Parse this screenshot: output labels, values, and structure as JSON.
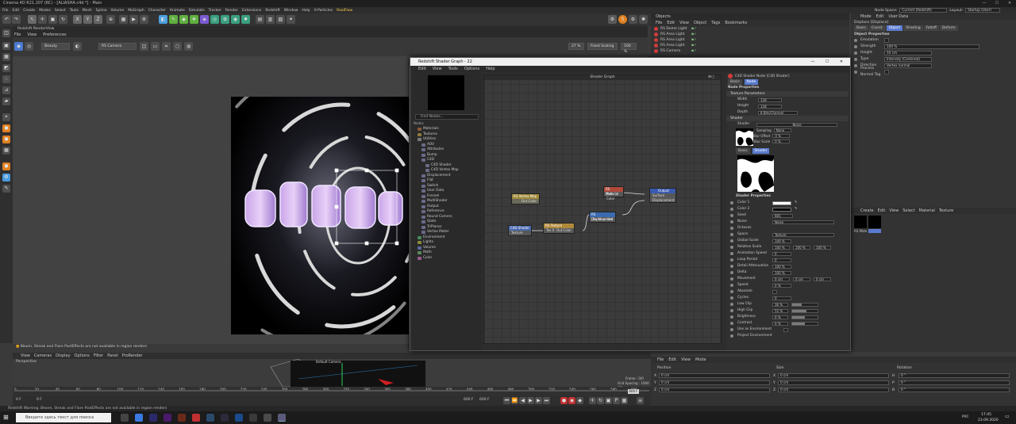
{
  "app": {
    "title": "Cinema 4D R21.207 (RC) - [ALIASHA.c4d *] - Main",
    "menu": [
      "File",
      "Edit",
      "Create",
      "Modes",
      "Select",
      "Tools",
      "Mesh",
      "Spline",
      "Volume",
      "MoGraph",
      "Character",
      "Animate",
      "Simulate",
      "Tracker",
      "Render",
      "Extensions",
      "Redshift",
      "Window",
      "Help",
      "X-Particles",
      "RealFlow"
    ],
    "node_space_label": "Node Space:",
    "node_space_value": "Current (Redshift)",
    "layout_label": "Layout:",
    "layout_value": "Startup (User)"
  },
  "toolbar": {
    "x": "X",
    "y": "Y",
    "z": "Z"
  },
  "renderview": {
    "title": "Redshift RenderView",
    "menu": [
      "File",
      "View",
      "Preferences"
    ],
    "beauty": "Beauty",
    "camera": "RS Camera",
    "zoom": "27 %",
    "fixed_scaling": "Fixed Scaling",
    "percent": "100 %",
    "warning": "Bloom, Streak and Flare PostEffects are not available in region renders"
  },
  "viewport": {
    "menu": [
      "View",
      "Cameras",
      "Display",
      "Options",
      "Filter",
      "Panel",
      "ProRender"
    ],
    "label": "Perspective",
    "camera_label": "Default Camera",
    "frame": "Frame : 0/0",
    "grid": "Grid Spacing : 1000 cm"
  },
  "timeline": {
    "ticks": [
      "0",
      "20",
      "40",
      "60",
      "80",
      "100",
      "120",
      "140",
      "160",
      "180",
      "200",
      "220",
      "240",
      "260",
      "280",
      "300",
      "320",
      "340",
      "360",
      "380",
      "400",
      "420",
      "440",
      "460",
      "480",
      "500",
      "520",
      "540",
      "560",
      "580",
      "600"
    ],
    "start": "0 F",
    "end_a": "600 F",
    "end_b": "600 F",
    "current": "600 F",
    "current_b": "0 F"
  },
  "statusbar": "Redshift Warning: Bloom, Streak and Flare PostEffects are not available in region renders",
  "taskbar": {
    "search": "Введите здесь текст для поиска",
    "time": "17:45",
    "date": "23.09.2020",
    "lang": "РУС"
  },
  "objects": {
    "title": "Objects",
    "menu": [
      "File",
      "Edit",
      "View",
      "Object",
      "Tags",
      "Bookmarks"
    ],
    "items": [
      "RS Dome Light",
      "RS Area Light",
      "RS Area Light",
      "RS Area Light",
      "RS Camera"
    ]
  },
  "attributes": {
    "menu": [
      "Mode",
      "Edit",
      "User Data"
    ],
    "object_name": "Displace [Displace]",
    "tabs": [
      "Basic",
      "Coord.",
      "Object",
      "Shading",
      "Falloff",
      "Deform"
    ],
    "active_tab": "Object",
    "section": "Object Properties",
    "rows": [
      {
        "label": "Emulation",
        "value": ""
      },
      {
        "label": "Strength",
        "value": "100 %"
      },
      {
        "label": "Height",
        "value": "10 cm"
      },
      {
        "label": "Type",
        "value": "Intensity (Centered)"
      },
      {
        "label": "Direction",
        "value": "Vertex normal"
      },
      {
        "label": "Process Normal Tag",
        "value": ""
      }
    ]
  },
  "materials": {
    "menu": [
      "Create",
      "Edit",
      "View",
      "Select",
      "Material",
      "Texture"
    ],
    "item": "RS Mate"
  },
  "coordinates": {
    "menu": [
      "File",
      "Edit",
      "View",
      "Mode"
    ],
    "headers": [
      "Position",
      "Size",
      "Rotation"
    ],
    "rows": [
      {
        "axis": "X",
        "pos": "0 cm",
        "size": "0 cm",
        "rot_axis": "H",
        "rot": "0 °"
      },
      {
        "axis": "Y",
        "pos": "0 cm",
        "size": "0 cm",
        "rot_axis": "P",
        "rot": "0 °"
      },
      {
        "axis": "Z",
        "pos": "0 cm",
        "size": "0 cm",
        "rot_axis": "B",
        "rot": "0 °"
      }
    ],
    "mode_a": "Object (Rel)",
    "mode_b": "Size",
    "apply": "Apply"
  },
  "shader_graph": {
    "title": "Redshift Shader Graph - 22",
    "menu": [
      "Edit",
      "View",
      "Tools",
      "Options",
      "Help"
    ],
    "find": "Find Nodes...",
    "nodes_label": "Nodes",
    "tree": [
      {
        "label": "Materials",
        "depth": 1
      },
      {
        "label": "Textures",
        "depth": 1
      },
      {
        "label": "Utilities",
        "depth": 1
      },
      {
        "label": "AOV",
        "depth": 2
      },
      {
        "label": "Attributes",
        "depth": 2
      },
      {
        "label": "Bump",
        "depth": 2
      },
      {
        "label": "C4D",
        "depth": 2
      },
      {
        "label": "C4D Shader",
        "depth": 3
      },
      {
        "label": "C4D Vertex Map",
        "depth": 3
      },
      {
        "label": "Displacement",
        "depth": 2
      },
      {
        "label": "Flat",
        "depth": 2
      },
      {
        "label": "Switch",
        "depth": 2
      },
      {
        "label": "User Data",
        "depth": 2
      },
      {
        "label": "Fresnel",
        "depth": 2
      },
      {
        "label": "MultiShader",
        "depth": 2
      },
      {
        "label": "Output",
        "depth": 2
      },
      {
        "label": "Reference",
        "depth": 2
      },
      {
        "label": "Round Corners",
        "depth": 2
      },
      {
        "label": "State",
        "depth": 2
      },
      {
        "label": "TriPlanar",
        "depth": 2
      },
      {
        "label": "Vertex Mater",
        "depth": 2
      },
      {
        "label": "Environment",
        "depth": 1
      },
      {
        "label": "Lights",
        "depth": 1
      },
      {
        "label": "Volume",
        "depth": 1
      },
      {
        "label": "Math",
        "depth": 1
      },
      {
        "label": "Color",
        "depth": 1
      }
    ],
    "canvas_title": "Shader Graph",
    "nodes": {
      "vmap": {
        "title": "RS Vertex Map",
        "port": "Out Color"
      },
      "c4dshader": {
        "title": "C4D Shader",
        "port": "Texture"
      },
      "texture": {
        "title": "RS Texture",
        "in": "Tex 0",
        "out": "Out Color"
      },
      "material": {
        "title": "RS Material",
        "port": "Out Color"
      },
      "displacement": {
        "title": "RS Displacement",
        "in": "Tex Map",
        "out": "Out"
      },
      "output": {
        "title": "Output",
        "p1": "Surface",
        "p2": "Displacement"
      }
    },
    "props": {
      "header": "C4D Shader Node [C4D Shader]",
      "tabs": [
        "Basic",
        "Node"
      ],
      "node_props": "Node Properties",
      "tex_params": "Texture Parameters",
      "width_label": "Width",
      "width": "128",
      "height_label": "Height",
      "height": "128",
      "depth_label": "Depth",
      "depth": "8 Bits/Channel",
      "shader_section": "Shader",
      "shader_label": "Shader",
      "shader_value": "Noise",
      "sampling_label": "Sampling",
      "sampling_value": "None",
      "blur_offset_label": "Blur Offset",
      "blur_offset": "0 %",
      "blur_scale_label": "Blur Scale",
      "blur_scale": "0 %",
      "subtabs": [
        "Basic",
        "Shader"
      ],
      "shader_props": "Shader Properties",
      "color1_label": "Color 1",
      "color2_label": "Color 2",
      "seed_label": "Seed",
      "seed": "665",
      "noise_label": "Noise",
      "noise": "Noise",
      "octaves_label": "Octaves",
      "space_label": "Space",
      "space": "Texture",
      "global_scale_label": "Global Scale",
      "global_scale": "100 %",
      "relative_scale_label": "Relative Scale",
      "rs1": "100 %",
      "rs2": "100 %",
      "rs3": "100 %",
      "anim_speed_label": "Animation Speed",
      "anim_speed": "0",
      "loop_label": "Loop Period",
      "loop": "0",
      "detail_label": "Detail Attenuation",
      "detail": "100 %",
      "delta_label": "Delta",
      "delta": "100 %",
      "movement_label": "Movement",
      "mv1": "0 cm",
      "mv2": "0 cm",
      "mv3": "0 cm",
      "speed_label": "Speed",
      "speed": "0 %",
      "absolute_label": "Absolute",
      "cycles_label": "Cycles",
      "cycles": "0",
      "low_clip_label": "Low Clip",
      "low_clip": 0.36,
      "low_clip_txt": "36 %",
      "high_clip_label": "High Clip",
      "high_clip": 0.55,
      "high_clip_txt": "55 %",
      "brightness_label": "Brightness",
      "brightness": 0.5,
      "brightness_txt": "0 %",
      "contrast_label": "Contrast",
      "contrast": 0.5,
      "contrast_txt": "0 %",
      "env_label": "Use as Environment",
      "project_env_label": "Project Environment"
    }
  },
  "colors": {
    "accent": "#5a7bd0",
    "redshift": "#d23a3a",
    "menu_highlight": "#ffd04a"
  }
}
